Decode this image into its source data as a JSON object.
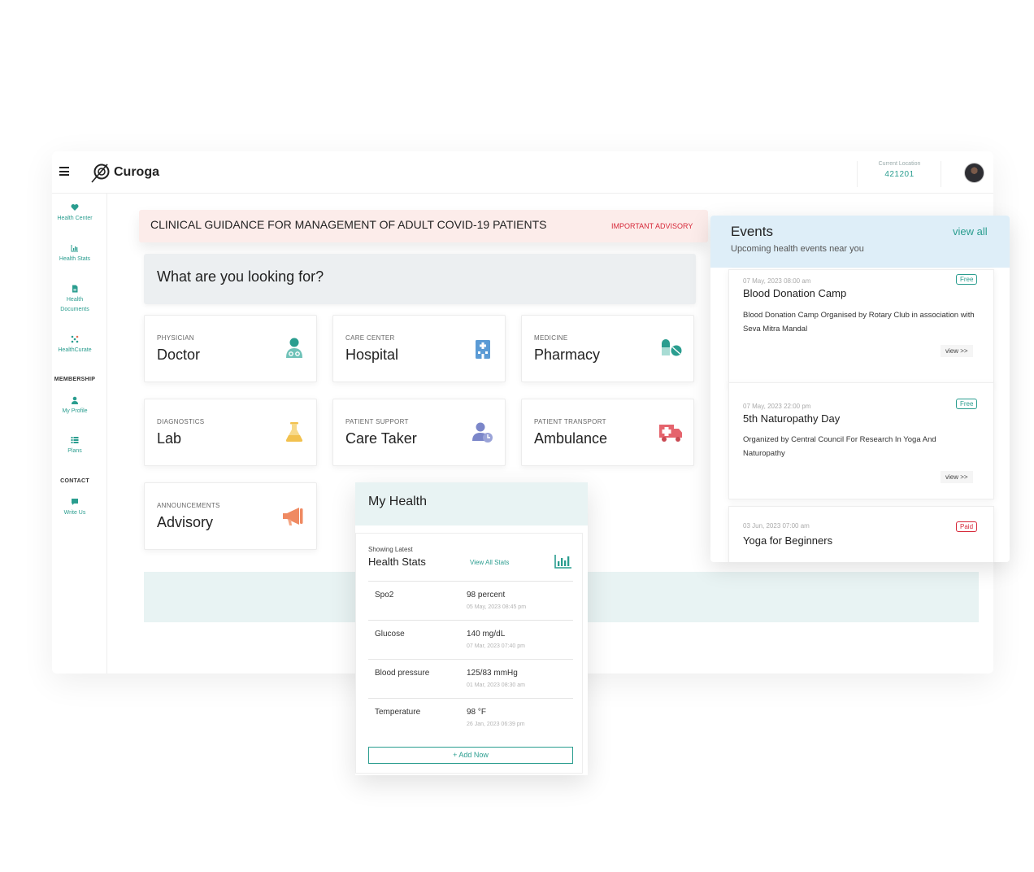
{
  "header": {
    "brand": "Curoga",
    "location_label": "Current Location",
    "location_value": "421201"
  },
  "sidebar": {
    "items": [
      {
        "label": "Health Center",
        "icon": "heart-pulse-icon"
      },
      {
        "label": "Health Stats",
        "icon": "chart-icon"
      },
      {
        "label": "Health Documents",
        "icon": "document-icon"
      },
      {
        "label": "HealthCurate",
        "icon": "dots-icon"
      }
    ],
    "membership_heading": "MEMBERSHIP",
    "membership_items": [
      {
        "label": "My Profile",
        "icon": "user-icon"
      },
      {
        "label": "Plans",
        "icon": "list-icon"
      }
    ],
    "contact_heading": "CONTACT",
    "contact_items": [
      {
        "label": "Write Us",
        "icon": "chat-icon"
      }
    ]
  },
  "advisory": {
    "text": "CLINICAL GUIDANCE FOR MANAGEMENT OF ADULT COVID-19 PATIENTS",
    "tag": "IMPORTANT ADVISORY"
  },
  "search": {
    "prompt": "What are you looking for?"
  },
  "categories": [
    {
      "category": "PHYSICIAN",
      "title": "Doctor",
      "icon": "doctor-icon"
    },
    {
      "category": "CARE CENTER",
      "title": "Hospital",
      "icon": "hospital-icon"
    },
    {
      "category": "MEDICINE",
      "title": "Pharmacy",
      "icon": "pills-icon"
    },
    {
      "category": "DIAGNOSTICS",
      "title": "Lab",
      "icon": "flask-icon"
    },
    {
      "category": "PATIENT SUPPORT",
      "title": "Care Taker",
      "icon": "caretaker-icon"
    },
    {
      "category": "PATIENT TRANSPORT",
      "title": "Ambulance",
      "icon": "ambulance-icon"
    },
    {
      "category": "ANNOUNCEMENTS",
      "title": "Advisory",
      "icon": "megaphone-icon"
    }
  ],
  "my_health": {
    "title": "My Health",
    "showing_latest": "Showing Latest",
    "stats_title": "Health Stats",
    "view_all": "View All Stats",
    "stats": [
      {
        "label": "Spo2",
        "value": "98 percent",
        "date": "05 May, 2023 08:45 pm"
      },
      {
        "label": "Glucose",
        "value": "140 mg/dL",
        "date": "07 Mar, 2023 07:40 pm"
      },
      {
        "label": "Blood pressure",
        "value": "125/83 mmHg",
        "date": "01 Mar, 2023 08:30 am"
      },
      {
        "label": "Temperature",
        "value": "98 °F",
        "date": "26 Jan, 2023 06:39 pm"
      }
    ],
    "add_button": "+ Add Now"
  },
  "events": {
    "title": "Events",
    "view_all": "view all",
    "subtitle": "Upcoming health events near you",
    "items": [
      {
        "date": "07 May, 2023 08:00 am",
        "name": "Blood Donation Camp",
        "description": "Blood Donation Camp Organised by Rotary Club in association with Seva Mitra Mandal",
        "badge": "Free",
        "view": "view >>"
      },
      {
        "date": "07 May, 2023 22:00 pm",
        "name": "5th Naturopathy Day",
        "description": "Organized by Central Council For Research In Yoga And Naturopathy",
        "badge": "Free",
        "view": "view >>"
      },
      {
        "date": "03 Jun, 2023 07:00 am",
        "name": "Yoga for Beginners",
        "description": "",
        "badge": "Paid",
        "view": ""
      }
    ]
  },
  "colors": {
    "accent": "#2a9d8f",
    "alert": "#d62839",
    "advisory_bg": "#fcecea",
    "events_header_bg": "#deeef8",
    "health_header_bg": "#e8f3f3"
  }
}
